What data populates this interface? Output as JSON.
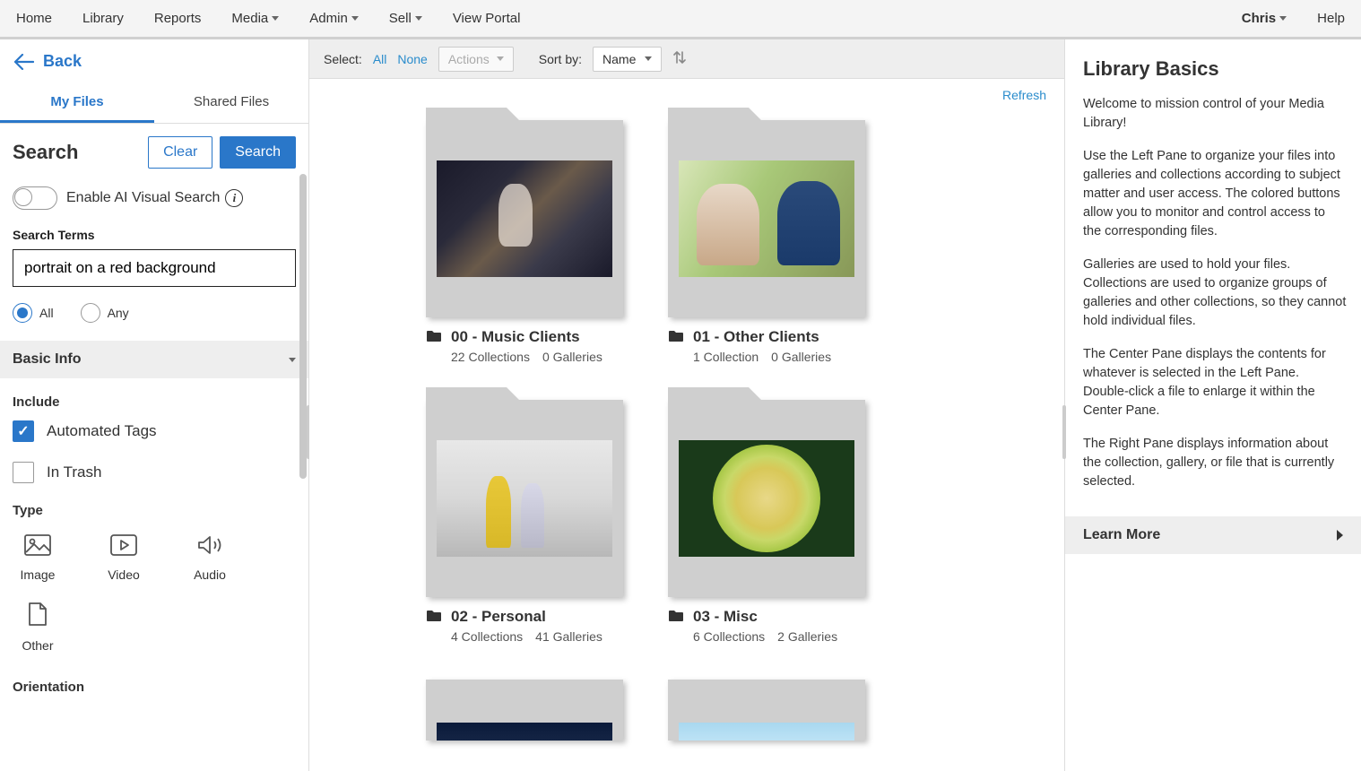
{
  "nav": {
    "items": [
      "Home",
      "Library",
      "Reports",
      "Media",
      "Admin",
      "Sell",
      "View Portal"
    ],
    "dropdowns": [
      false,
      false,
      false,
      true,
      true,
      true,
      false
    ],
    "user": "Chris",
    "help": "Help"
  },
  "left": {
    "back": "Back",
    "tabs": {
      "my_files": "My Files",
      "shared": "Shared Files"
    },
    "search_title": "Search",
    "clear": "Clear",
    "search_btn": "Search",
    "ai_toggle_label": "Enable AI Visual Search",
    "terms_label": "Search Terms",
    "terms_value": "portrait on a red background",
    "radio_all": "All",
    "radio_any": "Any",
    "basic_info": "Basic Info",
    "include_label": "Include",
    "auto_tags": "Automated Tags",
    "in_trash": "In Trash",
    "type_label": "Type",
    "types": [
      "Image",
      "Video",
      "Audio",
      "Other"
    ],
    "orientation_label": "Orientation"
  },
  "toolbar": {
    "select_label": "Select:",
    "all": "All",
    "none": "None",
    "actions": "Actions",
    "sort_label": "Sort by:",
    "sort_value": "Name",
    "refresh": "Refresh"
  },
  "folders": [
    {
      "title": "00 - Music Clients",
      "collections": "22 Collections",
      "galleries": "0 Galleries",
      "thumb": "concert"
    },
    {
      "title": "01 - Other Clients",
      "collections": "1 Collection",
      "galleries": "0 Galleries",
      "thumb": "wedding"
    },
    {
      "title": "02 - Personal",
      "collections": "4 Collections",
      "galleries": "41 Galleries",
      "thumb": "kids"
    },
    {
      "title": "03 - Misc",
      "collections": "6 Collections",
      "galleries": "2 Galleries",
      "thumb": "melon"
    },
    {
      "title": "",
      "collections": "",
      "galleries": "",
      "thumb": "dark"
    },
    {
      "title": "",
      "collections": "",
      "galleries": "",
      "thumb": "sky"
    }
  ],
  "right": {
    "title": "Library Basics",
    "p1": "Welcome to mission control of your Media Library!",
    "p2": "Use the Left Pane to organize your files into galleries and collections according to subject matter and user access. The colored buttons allow you to monitor and control access to the corresponding files.",
    "p3": "Galleries are used to hold your files. Collections are used to organize groups of galleries and other collections, so they cannot hold individual files.",
    "p4": "The Center Pane displays the contents for whatever is selected in the Left Pane. Double-click a file to enlarge it within the Center Pane.",
    "p5": "The Right Pane displays information about the collection, gallery, or file that is currently selected.",
    "learn_more": "Learn More"
  }
}
